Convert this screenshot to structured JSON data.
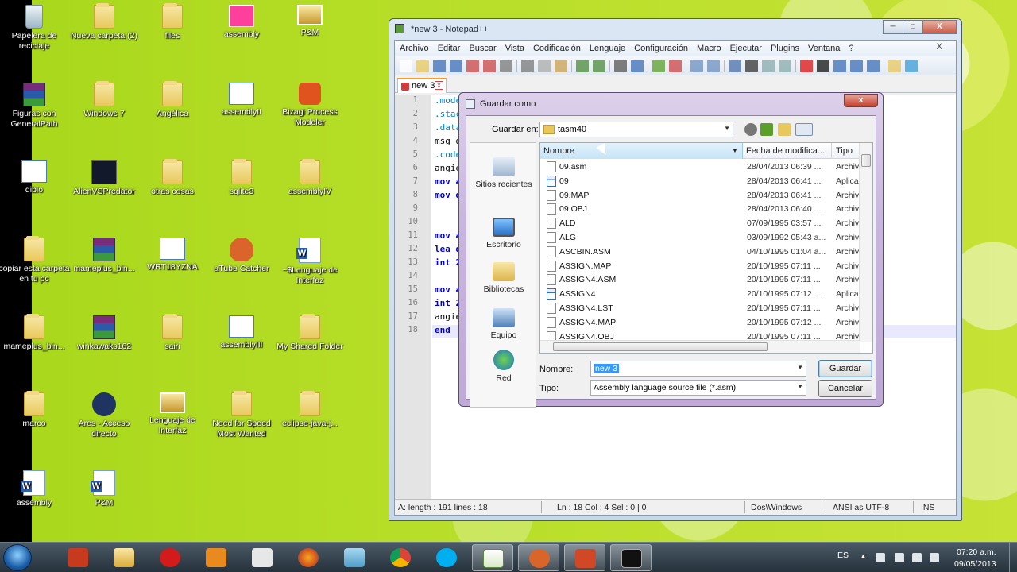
{
  "desktop": {
    "icons": [
      {
        "label": "Papelera de reciclaje",
        "icon": "recycle-bin-icon"
      },
      {
        "label": "Nueva carpeta (2)",
        "icon": "folder-icon"
      },
      {
        "label": "files",
        "icon": "folder-icon"
      },
      {
        "label": "assembly",
        "icon": "image-icon"
      },
      {
        "label": "P&M",
        "icon": "image-icon"
      },
      {
        "label": "Figuras con GeneralPath",
        "icon": "rar-icon"
      },
      {
        "label": "Windows 7",
        "icon": "folder-icon"
      },
      {
        "label": "Angélica",
        "icon": "folder-icon"
      },
      {
        "label": "assemblyII",
        "icon": "document-icon"
      },
      {
        "label": "Bizagi Process Modeler",
        "icon": "bizagi-icon"
      },
      {
        "label": "dibio",
        "icon": "program-icon"
      },
      {
        "label": "AlienVSPredator",
        "icon": "movie-icon"
      },
      {
        "label": "otras cosas",
        "icon": "folder-icon"
      },
      {
        "label": "sqlite3",
        "icon": "folder-icon"
      },
      {
        "label": "assemblyIV",
        "icon": "folder-icon"
      },
      {
        "label": "copiar esta carpeta en tu pc",
        "icon": "folder-icon"
      },
      {
        "label": "mameplus_bin...",
        "icon": "rar-icon"
      },
      {
        "label": "WRT18YZNA",
        "icon": "document-icon"
      },
      {
        "label": "aTube Catcher",
        "icon": "glove-icon"
      },
      {
        "label": "~$Lenguaje de Interfaz",
        "icon": "word-icon"
      },
      {
        "label": "mameplus_bin...",
        "icon": "folder-icon"
      },
      {
        "label": "winkawaks162",
        "icon": "rar-icon"
      },
      {
        "label": "sairi",
        "icon": "folder-icon"
      },
      {
        "label": "assemblyIII",
        "icon": "document-icon"
      },
      {
        "label": "My Shared Folder",
        "icon": "folder-icon"
      },
      {
        "label": "marco",
        "icon": "folder-icon"
      },
      {
        "label": "Ares - Acceso directo",
        "icon": "ares-icon"
      },
      {
        "label": "Lenguaje de Interfaz",
        "icon": "image-icon"
      },
      {
        "label": "Need for Speed Most Wanted",
        "icon": "folder-icon"
      },
      {
        "label": "eclipse-java-j...",
        "icon": "folder-icon"
      },
      {
        "label": "assembly",
        "icon": "word-icon"
      },
      {
        "label": "P&M",
        "icon": "word-icon"
      }
    ]
  },
  "notepad": {
    "title": "*new  3 - Notepad++",
    "window_buttons": {
      "minimize": "─",
      "maximize": "□",
      "close": "X"
    },
    "menu": [
      "Archivo",
      "Editar",
      "Buscar",
      "Vista",
      "Codificación",
      "Lenguaje",
      "Configuración",
      "Macro",
      "Ejecutar",
      "Plugins",
      "Ventana",
      "?"
    ],
    "mdi_close": "X",
    "tab_label": "new  3",
    "tab_close": "x",
    "line_numbers": [
      "1",
      "2",
      "3",
      "4",
      "5",
      "6",
      "7",
      "8",
      "9",
      "10",
      "11",
      "12",
      "13",
      "14",
      "15",
      "16",
      "17",
      "18"
    ],
    "code_lines": [
      ".mode",
      ".stac",
      ".data",
      "msg d",
      ".code",
      "angie",
      "mov a",
      "mov d",
      "",
      "",
      "mov a",
      "lea d",
      "int 2",
      "",
      "mov a",
      "int 2",
      "angie",
      "end"
    ],
    "status": {
      "length": "A: length : 191    lines : 18",
      "position": "Ln : 18    Col : 4    Sel : 0 | 0",
      "eol": "Dos\\Windows",
      "encoding": "ANSI as UTF-8",
      "mode": "INS"
    }
  },
  "dialog": {
    "title": "Guardar como",
    "close": "x",
    "lookin_label": "Guardar en:",
    "lookin_value": "tasm40",
    "places": [
      "Sitios recientes",
      "Escritorio",
      "Bibliotecas",
      "Equipo",
      "Red"
    ],
    "columns": {
      "name": "Nombre",
      "date": "Fecha de modifica...",
      "type": "Tipo"
    },
    "files": [
      {
        "name": "09.asm",
        "date": "28/04/2013 06:39 ...",
        "type": "Archiv",
        "kind": "file"
      },
      {
        "name": "09",
        "date": "28/04/2013 06:41 ...",
        "type": "Aplicac",
        "kind": "exe"
      },
      {
        "name": "09.MAP",
        "date": "28/04/2013 06:41 ...",
        "type": "Archiv",
        "kind": "file"
      },
      {
        "name": "09.OBJ",
        "date": "28/04/2013 06:40 ...",
        "type": "Archiv",
        "kind": "file"
      },
      {
        "name": "ALD",
        "date": "07/09/1995 03:57 ...",
        "type": "Archiv",
        "kind": "file"
      },
      {
        "name": "ALG",
        "date": "03/09/1992 05:43 a...",
        "type": "Archiv",
        "kind": "file"
      },
      {
        "name": "ASCBIN.ASM",
        "date": "04/10/1995 01:04 a...",
        "type": "Archiv",
        "kind": "file"
      },
      {
        "name": "ASSIGN.MAP",
        "date": "20/10/1995 07:11 ...",
        "type": "Archiv",
        "kind": "file"
      },
      {
        "name": "ASSIGN4.ASM",
        "date": "20/10/1995 07:11 ...",
        "type": "Archiv",
        "kind": "file"
      },
      {
        "name": "ASSIGN4",
        "date": "20/10/1995 07:12 ...",
        "type": "Aplicac",
        "kind": "exe"
      },
      {
        "name": "ASSIGN4.LST",
        "date": "20/10/1995 07:11 ...",
        "type": "Archiv",
        "kind": "file"
      },
      {
        "name": "ASSIGN4.MAP",
        "date": "20/10/1995 07:12 ...",
        "type": "Archiv",
        "kind": "file"
      },
      {
        "name": "ASSIGN4.OBJ",
        "date": "20/10/1995 07:11 ...",
        "type": "Archiv",
        "kind": "file"
      }
    ],
    "filename_label": "Nombre:",
    "filename_value": "new  3",
    "type_label": "Tipo:",
    "type_value": "Assembly language source file (*.asm)",
    "save_button": "Guardar",
    "cancel_button": "Cancelar"
  },
  "taskbar": {
    "language": "ES",
    "time": "07:20 a.m.",
    "date": "09/05/2013"
  }
}
